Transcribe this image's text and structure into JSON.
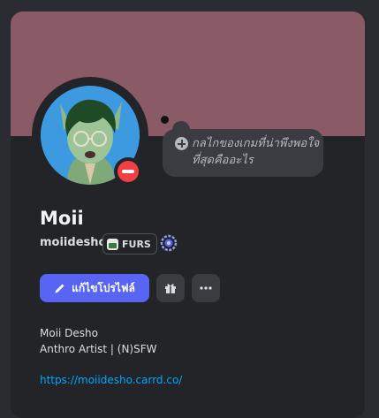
{
  "colors": {
    "banner": "#8a5b66",
    "card": "#232428",
    "status_dnd": "#f23f43",
    "accent": "#5865f2",
    "link": "#00a8fc"
  },
  "profile": {
    "display_name": "Moii",
    "username": "moiidesho",
    "status_text": "กลไกของเกมที่น่าพึงพอใจที่สุดคืออะไร",
    "status_icon": "add-circle-icon",
    "presence": "do-not-disturb",
    "tag": {
      "label": "FURS",
      "icon": "guild-tag-icon"
    },
    "badge_icon": "nitro-badge-icon"
  },
  "actions": {
    "edit_label": "แก้ไขโปรไฟล์",
    "edit_icon": "pencil-icon",
    "gift_icon": "gift-icon",
    "more_icon": "more-dots-icon"
  },
  "bio": {
    "lines": [
      "Moii Desho",
      "Anthro Artist | (N)SFW"
    ],
    "link": "https://moiidesho.carrd.co/"
  }
}
